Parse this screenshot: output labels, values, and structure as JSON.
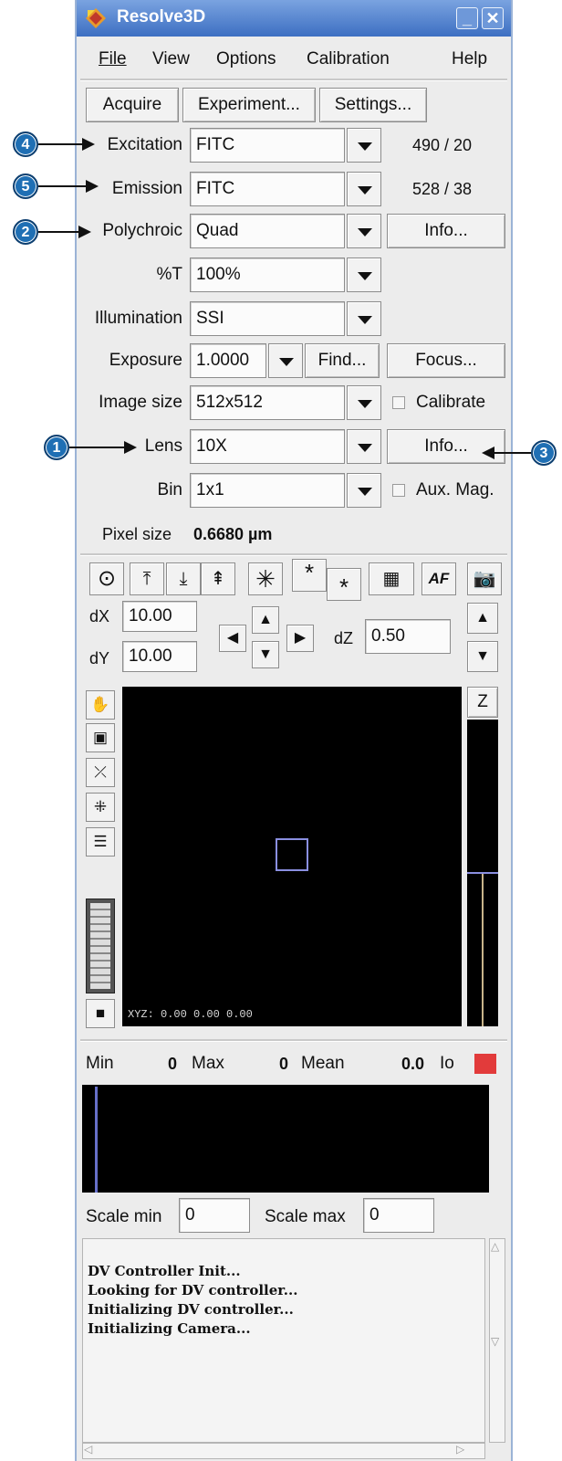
{
  "window": {
    "title": "Resolve3D"
  },
  "menu": [
    "File",
    "View",
    "Options",
    "Calibration",
    "Help"
  ],
  "toolbar": {
    "acquire": "Acquire",
    "experiment": "Experiment...",
    "settings": "Settings..."
  },
  "rows": {
    "excitation": {
      "label": "Excitation",
      "value": "FITC",
      "info": "490 / 20"
    },
    "emission": {
      "label": "Emission",
      "value": "FITC",
      "info": "528 / 38"
    },
    "polychroic": {
      "label": "Polychroic",
      "value": "Quad",
      "button": "Info..."
    },
    "percent_t": {
      "label": "%T",
      "value": "100%"
    },
    "illumination": {
      "label": "Illumination",
      "value": "SSI"
    },
    "exposure": {
      "label": "Exposure",
      "value": "1.0000",
      "find": "Find...",
      "focus": "Focus..."
    },
    "image_size": {
      "label": "Image size",
      "value": "512x512",
      "checkbox": "Calibrate"
    },
    "lens": {
      "label": "Lens",
      "value": "10X",
      "button": "Info..."
    },
    "bin": {
      "label": "Bin",
      "value": "1x1",
      "checkbox": "Aux. Mag."
    },
    "pixel": {
      "label": "Pixel size",
      "value": "0.6680 µm"
    }
  },
  "callouts": [
    "4",
    "5",
    "2",
    "1",
    "3"
  ],
  "stage": {
    "dx_label": "dX",
    "dx": "10.00",
    "dy_label": "dY",
    "dy": "10.00",
    "dz_label": "dZ",
    "dz": "0.50"
  },
  "tools": {
    "af": "AF",
    "z": "Z"
  },
  "view": {
    "coords": "XYZ: 0.00 0.00 0.00"
  },
  "stats": {
    "min_label": "Min",
    "min": "0",
    "max_label": "Max",
    "max": "0",
    "mean_label": "Mean",
    "mean": "0.0",
    "io_label": "Io",
    "io_color": "#e23b3b"
  },
  "scale": {
    "min_label": "Scale min",
    "min": "0",
    "max_label": "Scale max",
    "max": "0"
  },
  "log": [
    "DV Controller Init...",
    "Looking for DV controller...",
    "Initializing DV controller...",
    "Initializing Camera..."
  ]
}
